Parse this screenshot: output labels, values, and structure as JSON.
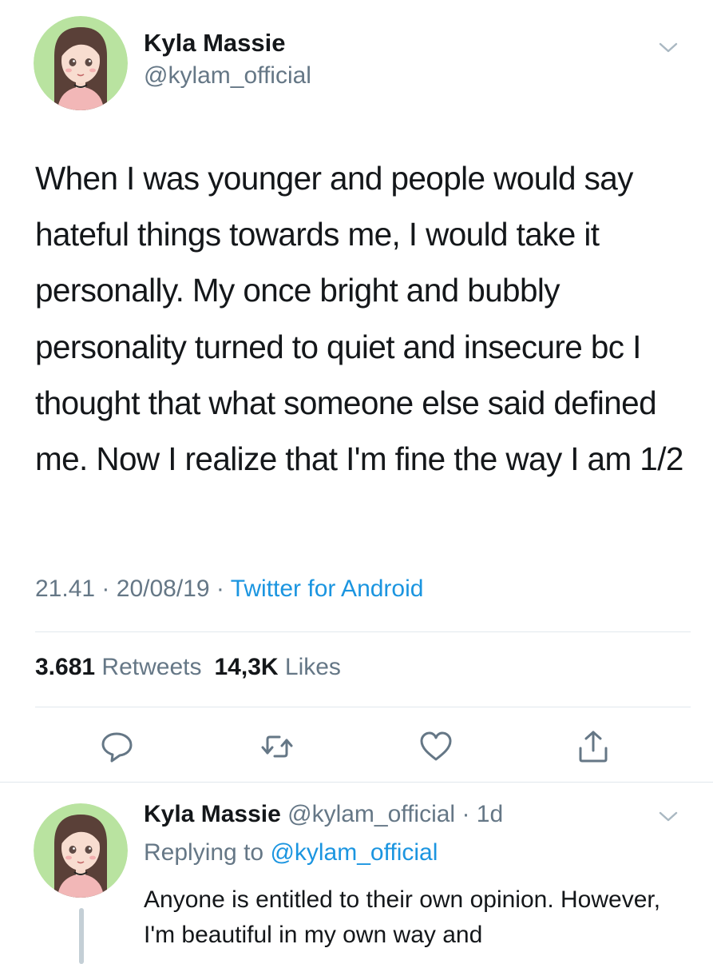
{
  "main_tweet": {
    "author_name": "Kyla Massie",
    "author_handle": "@kylam_official",
    "text": "When I was younger and people would say hateful things towards me, I would take it personally. My once bright and bubbly personality turned to quiet and insecure bc I thought that what someone else said defined me. Now I realize that I'm fine the way I am 1/2",
    "time": "21.41",
    "date": "20/08/19",
    "separator": "·",
    "source": "Twitter for Android",
    "retweet_count": "3.681",
    "retweet_label": "Retweets",
    "like_count": "14,3K",
    "like_label": "Likes"
  },
  "reply_tweet": {
    "author_name": "Kyla Massie",
    "author_handle": "@kylam_official",
    "age": "1d",
    "replying_to_label": "Replying to",
    "replying_to_handle": "@kylam_official",
    "text": "Anyone is entitled to their own opinion. However, I'm beautiful in my own way and"
  },
  "icons": {
    "caret": "chevron-down-icon",
    "reply": "reply-icon",
    "retweet": "retweet-icon",
    "like": "heart-icon",
    "share": "share-icon"
  },
  "colors": {
    "text": "#14171a",
    "secondary": "#657786",
    "link": "#1b95e0",
    "divider": "#e1e8ed",
    "avatar_bg": "#b9e3a0"
  }
}
